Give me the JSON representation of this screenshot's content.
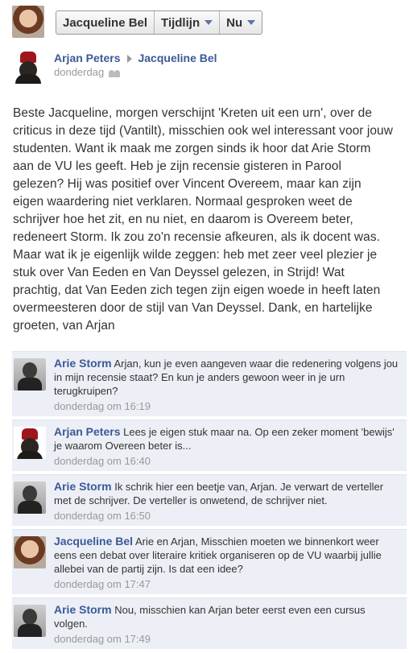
{
  "header": {
    "profile_name": "Jacqueline Bel",
    "menu_timeline": "Tijdlijn",
    "menu_now": "Nu"
  },
  "post": {
    "author": "Arjan Peters",
    "target": "Jacqueline Bel",
    "timestamp": "donderdag",
    "audience_icon": "friends-icon",
    "body": "Beste Jacqueline, morgen verschijnt 'Kreten uit een urn', over de criticus in deze tijd (Vantilt), misschien ook wel interessant voor jouw studenten. Want ik maak me zorgen sinds ik hoor dat Arie Storm aan de VU les geeft. Heb je zijn recensie gisteren in Parool gelezen? Hij was positief over Vincent Overeem, maar kan zijn eigen waardering niet verklaren. Normaal gesproken weet de schrijver hoe het zit, en nu niet, en daarom is Overeem beter, redeneert Storm. Ik zou zo'n recensie afkeuren, als ik docent was. Maar wat ik je eigenlijk wilde zeggen: heb met zeer veel plezier je stuk over Van Eeden en Van Deyssel gelezen, in Strijd! Wat prachtig, dat Van Eeden zich tegen zijn eigen woede in heeft laten overmeesteren door de stijl van Van Deyssel. Dank, en hartelijke groeten, van Arjan"
  },
  "comments": [
    {
      "name": "Arie Storm",
      "text": "Arjan, kun je even aangeven waar die redenering volgens jou in mijn recensie staat? En kun je anders gewoon weer in je urn terugkruipen?",
      "time": "donderdag om 16:19"
    },
    {
      "name": "Arjan Peters",
      "text": "Lees je eigen stuk maar na. Op een zeker moment 'bewijs' je waarom Overeen beter is...",
      "time": "donderdag om 16:40"
    },
    {
      "name": "Arie Storm",
      "text": "Ik schrik hier een beetje van, Arjan. Je verwart de verteller met de schrijver. De verteller is onwetend, de schrijver niet.",
      "time": "donderdag om 16:50"
    },
    {
      "name": "Jacqueline Bel",
      "text": "Arie en Arjan, Misschien moeten we binnenkort weer eens een debat over literaire kritiek organiseren op de VU waarbij jullie allebei van de partij zijn. Is dat een idee?",
      "time": "donderdag om 17:47"
    },
    {
      "name": "Arie Storm",
      "text": "Nou, misschien kan Arjan beter eerst even een cursus volgen.",
      "time": "donderdag om 17:49"
    }
  ]
}
